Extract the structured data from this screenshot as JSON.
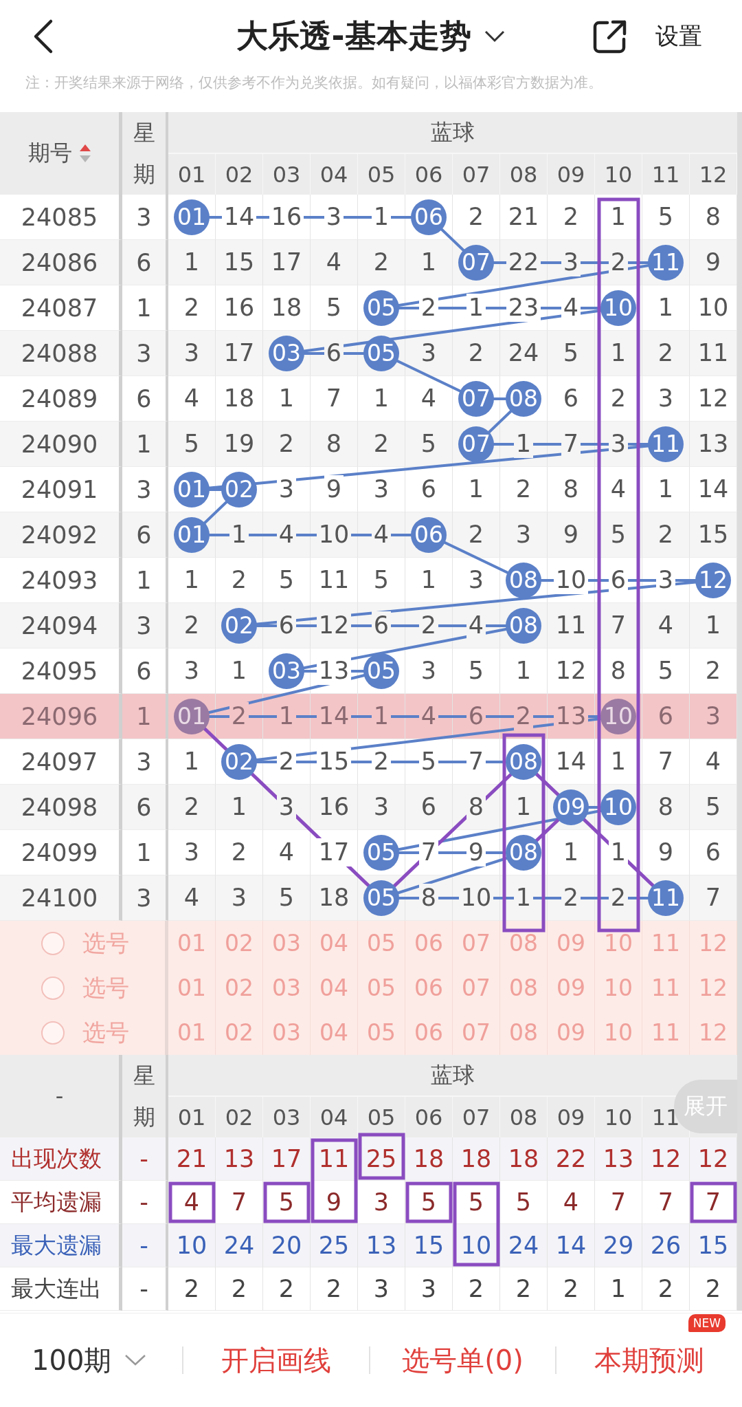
{
  "header": {
    "title": "大乐透-基本走势",
    "action": "设置"
  },
  "notice": "注：开奖结果来源于网络，仅供参考不作为兑奖依据。如有疑问，以福体彩官方数据为准。",
  "table": {
    "period_label": "期号",
    "sort_ascending": true,
    "weekday_top": "星",
    "weekday_bottom": "期",
    "group": "蓝球",
    "numbers": [
      "01",
      "02",
      "03",
      "04",
      "05",
      "06",
      "07",
      "08",
      "09",
      "10",
      "11",
      "12"
    ],
    "rows": [
      {
        "period": "24085",
        "weekday": "3",
        "selected": false,
        "cells": [
          {
            "text": "01",
            "hit": true
          },
          {
            "text": "14",
            "hit": false
          },
          {
            "text": "16",
            "hit": false
          },
          {
            "text": "3",
            "hit": false
          },
          {
            "text": "1",
            "hit": false
          },
          {
            "text": "06",
            "hit": true
          },
          {
            "text": "2",
            "hit": false
          },
          {
            "text": "21",
            "hit": false
          },
          {
            "text": "2",
            "hit": false
          },
          {
            "text": "1",
            "hit": false
          },
          {
            "text": "5",
            "hit": false
          },
          {
            "text": "8",
            "hit": false
          }
        ]
      },
      {
        "period": "24086",
        "weekday": "6",
        "selected": false,
        "cells": [
          {
            "text": "1",
            "hit": false
          },
          {
            "text": "15",
            "hit": false
          },
          {
            "text": "17",
            "hit": false
          },
          {
            "text": "4",
            "hit": false
          },
          {
            "text": "2",
            "hit": false
          },
          {
            "text": "1",
            "hit": false
          },
          {
            "text": "07",
            "hit": true
          },
          {
            "text": "22",
            "hit": false
          },
          {
            "text": "3",
            "hit": false
          },
          {
            "text": "2",
            "hit": false
          },
          {
            "text": "11",
            "hit": true
          },
          {
            "text": "9",
            "hit": false
          }
        ]
      },
      {
        "period": "24087",
        "weekday": "1",
        "selected": false,
        "cells": [
          {
            "text": "2",
            "hit": false
          },
          {
            "text": "16",
            "hit": false
          },
          {
            "text": "18",
            "hit": false
          },
          {
            "text": "5",
            "hit": false
          },
          {
            "text": "05",
            "hit": true
          },
          {
            "text": "2",
            "hit": false
          },
          {
            "text": "1",
            "hit": false
          },
          {
            "text": "23",
            "hit": false
          },
          {
            "text": "4",
            "hit": false
          },
          {
            "text": "10",
            "hit": true
          },
          {
            "text": "1",
            "hit": false
          },
          {
            "text": "10",
            "hit": false
          }
        ]
      },
      {
        "period": "24088",
        "weekday": "3",
        "selected": false,
        "cells": [
          {
            "text": "3",
            "hit": false
          },
          {
            "text": "17",
            "hit": false
          },
          {
            "text": "03",
            "hit": true
          },
          {
            "text": "6",
            "hit": false
          },
          {
            "text": "05",
            "hit": true
          },
          {
            "text": "3",
            "hit": false
          },
          {
            "text": "2",
            "hit": false
          },
          {
            "text": "24",
            "hit": false
          },
          {
            "text": "5",
            "hit": false
          },
          {
            "text": "1",
            "hit": false
          },
          {
            "text": "2",
            "hit": false
          },
          {
            "text": "11",
            "hit": false
          }
        ]
      },
      {
        "period": "24089",
        "weekday": "6",
        "selected": false,
        "cells": [
          {
            "text": "4",
            "hit": false
          },
          {
            "text": "18",
            "hit": false
          },
          {
            "text": "1",
            "hit": false
          },
          {
            "text": "7",
            "hit": false
          },
          {
            "text": "1",
            "hit": false
          },
          {
            "text": "4",
            "hit": false
          },
          {
            "text": "07",
            "hit": true
          },
          {
            "text": "08",
            "hit": true
          },
          {
            "text": "6",
            "hit": false
          },
          {
            "text": "2",
            "hit": false
          },
          {
            "text": "3",
            "hit": false
          },
          {
            "text": "12",
            "hit": false
          }
        ]
      },
      {
        "period": "24090",
        "weekday": "1",
        "selected": false,
        "cells": [
          {
            "text": "5",
            "hit": false
          },
          {
            "text": "19",
            "hit": false
          },
          {
            "text": "2",
            "hit": false
          },
          {
            "text": "8",
            "hit": false
          },
          {
            "text": "2",
            "hit": false
          },
          {
            "text": "5",
            "hit": false
          },
          {
            "text": "07",
            "hit": true
          },
          {
            "text": "1",
            "hit": false
          },
          {
            "text": "7",
            "hit": false
          },
          {
            "text": "3",
            "hit": false
          },
          {
            "text": "11",
            "hit": true
          },
          {
            "text": "13",
            "hit": false
          }
        ]
      },
      {
        "period": "24091",
        "weekday": "3",
        "selected": false,
        "cells": [
          {
            "text": "01",
            "hit": true
          },
          {
            "text": "02",
            "hit": true
          },
          {
            "text": "3",
            "hit": false
          },
          {
            "text": "9",
            "hit": false
          },
          {
            "text": "3",
            "hit": false
          },
          {
            "text": "6",
            "hit": false
          },
          {
            "text": "1",
            "hit": false
          },
          {
            "text": "2",
            "hit": false
          },
          {
            "text": "8",
            "hit": false
          },
          {
            "text": "4",
            "hit": false
          },
          {
            "text": "1",
            "hit": false
          },
          {
            "text": "14",
            "hit": false
          }
        ]
      },
      {
        "period": "24092",
        "weekday": "6",
        "selected": false,
        "cells": [
          {
            "text": "01",
            "hit": true
          },
          {
            "text": "1",
            "hit": false
          },
          {
            "text": "4",
            "hit": false
          },
          {
            "text": "10",
            "hit": false
          },
          {
            "text": "4",
            "hit": false
          },
          {
            "text": "06",
            "hit": true
          },
          {
            "text": "2",
            "hit": false
          },
          {
            "text": "3",
            "hit": false
          },
          {
            "text": "9",
            "hit": false
          },
          {
            "text": "5",
            "hit": false
          },
          {
            "text": "2",
            "hit": false
          },
          {
            "text": "15",
            "hit": false
          }
        ]
      },
      {
        "period": "24093",
        "weekday": "1",
        "selected": false,
        "cells": [
          {
            "text": "1",
            "hit": false
          },
          {
            "text": "2",
            "hit": false
          },
          {
            "text": "5",
            "hit": false
          },
          {
            "text": "11",
            "hit": false
          },
          {
            "text": "5",
            "hit": false
          },
          {
            "text": "1",
            "hit": false
          },
          {
            "text": "3",
            "hit": false
          },
          {
            "text": "08",
            "hit": true
          },
          {
            "text": "10",
            "hit": false
          },
          {
            "text": "6",
            "hit": false
          },
          {
            "text": "3",
            "hit": false
          },
          {
            "text": "12",
            "hit": true
          }
        ]
      },
      {
        "period": "24094",
        "weekday": "3",
        "selected": false,
        "cells": [
          {
            "text": "2",
            "hit": false
          },
          {
            "text": "02",
            "hit": true
          },
          {
            "text": "6",
            "hit": false
          },
          {
            "text": "12",
            "hit": false
          },
          {
            "text": "6",
            "hit": false
          },
          {
            "text": "2",
            "hit": false
          },
          {
            "text": "4",
            "hit": false
          },
          {
            "text": "08",
            "hit": true
          },
          {
            "text": "11",
            "hit": false
          },
          {
            "text": "7",
            "hit": false
          },
          {
            "text": "4",
            "hit": false
          },
          {
            "text": "1",
            "hit": false
          }
        ]
      },
      {
        "period": "24095",
        "weekday": "6",
        "selected": false,
        "cells": [
          {
            "text": "3",
            "hit": false
          },
          {
            "text": "1",
            "hit": false
          },
          {
            "text": "03",
            "hit": true
          },
          {
            "text": "13",
            "hit": false
          },
          {
            "text": "05",
            "hit": true
          },
          {
            "text": "3",
            "hit": false
          },
          {
            "text": "5",
            "hit": false
          },
          {
            "text": "1",
            "hit": false
          },
          {
            "text": "12",
            "hit": false
          },
          {
            "text": "8",
            "hit": false
          },
          {
            "text": "5",
            "hit": false
          },
          {
            "text": "2",
            "hit": false
          }
        ]
      },
      {
        "period": "24096",
        "weekday": "1",
        "selected": true,
        "cells": [
          {
            "text": "01",
            "hit": true
          },
          {
            "text": "2",
            "hit": false
          },
          {
            "text": "1",
            "hit": false
          },
          {
            "text": "14",
            "hit": false
          },
          {
            "text": "1",
            "hit": false
          },
          {
            "text": "4",
            "hit": false
          },
          {
            "text": "6",
            "hit": false
          },
          {
            "text": "2",
            "hit": false
          },
          {
            "text": "13",
            "hit": false
          },
          {
            "text": "10",
            "hit": true
          },
          {
            "text": "6",
            "hit": false
          },
          {
            "text": "3",
            "hit": false
          }
        ]
      },
      {
        "period": "24097",
        "weekday": "3",
        "selected": false,
        "cells": [
          {
            "text": "1",
            "hit": false
          },
          {
            "text": "02",
            "hit": true
          },
          {
            "text": "2",
            "hit": false
          },
          {
            "text": "15",
            "hit": false
          },
          {
            "text": "2",
            "hit": false
          },
          {
            "text": "5",
            "hit": false
          },
          {
            "text": "7",
            "hit": false
          },
          {
            "text": "08",
            "hit": true
          },
          {
            "text": "14",
            "hit": false
          },
          {
            "text": "1",
            "hit": false
          },
          {
            "text": "7",
            "hit": false
          },
          {
            "text": "4",
            "hit": false
          }
        ]
      },
      {
        "period": "24098",
        "weekday": "6",
        "selected": false,
        "cells": [
          {
            "text": "2",
            "hit": false
          },
          {
            "text": "1",
            "hit": false
          },
          {
            "text": "3",
            "hit": false
          },
          {
            "text": "16",
            "hit": false
          },
          {
            "text": "3",
            "hit": false
          },
          {
            "text": "6",
            "hit": false
          },
          {
            "text": "8",
            "hit": false
          },
          {
            "text": "1",
            "hit": false
          },
          {
            "text": "09",
            "hit": true
          },
          {
            "text": "10",
            "hit": true
          },
          {
            "text": "8",
            "hit": false
          },
          {
            "text": "5",
            "hit": false
          }
        ]
      },
      {
        "period": "24099",
        "weekday": "1",
        "selected": false,
        "cells": [
          {
            "text": "3",
            "hit": false
          },
          {
            "text": "2",
            "hit": false
          },
          {
            "text": "4",
            "hit": false
          },
          {
            "text": "17",
            "hit": false
          },
          {
            "text": "05",
            "hit": true
          },
          {
            "text": "7",
            "hit": false
          },
          {
            "text": "9",
            "hit": false
          },
          {
            "text": "08",
            "hit": true
          },
          {
            "text": "1",
            "hit": false
          },
          {
            "text": "1",
            "hit": false
          },
          {
            "text": "9",
            "hit": false
          },
          {
            "text": "6",
            "hit": false
          }
        ]
      },
      {
        "period": "24100",
        "weekday": "3",
        "selected": false,
        "cells": [
          {
            "text": "4",
            "hit": false
          },
          {
            "text": "3",
            "hit": false
          },
          {
            "text": "5",
            "hit": false
          },
          {
            "text": "18",
            "hit": false
          },
          {
            "text": "05",
            "hit": true
          },
          {
            "text": "8",
            "hit": false
          },
          {
            "text": "10",
            "hit": false
          },
          {
            "text": "1",
            "hit": false
          },
          {
            "text": "2",
            "hit": false
          },
          {
            "text": "2",
            "hit": false
          },
          {
            "text": "11",
            "hit": true
          },
          {
            "text": "7",
            "hit": false
          }
        ]
      }
    ]
  },
  "pick_rows": [
    {
      "label": "选号",
      "checked": false,
      "numbers": [
        "01",
        "02",
        "03",
        "04",
        "05",
        "06",
        "07",
        "08",
        "09",
        "10",
        "11",
        "12"
      ]
    },
    {
      "label": "选号",
      "checked": false,
      "numbers": [
        "01",
        "02",
        "03",
        "04",
        "05",
        "06",
        "07",
        "08",
        "09",
        "10",
        "11",
        "12"
      ]
    },
    {
      "label": "选号",
      "checked": false,
      "numbers": [
        "01",
        "02",
        "03",
        "04",
        "05",
        "06",
        "07",
        "08",
        "09",
        "10",
        "11",
        "12"
      ]
    }
  ],
  "stats": {
    "corner": "-",
    "weekday_top": "星",
    "weekday_bottom": "期",
    "group": "蓝球",
    "expand": "展开",
    "numbers": [
      "01",
      "02",
      "03",
      "04",
      "05",
      "06",
      "07",
      "08",
      "09",
      "10",
      "11"
    ],
    "rows": [
      {
        "label": "出现次数",
        "weekday": "-",
        "color": "#b0302e",
        "values": [
          "21",
          "13",
          "17",
          "11",
          "25",
          "18",
          "18",
          "18",
          "22",
          "13",
          "12",
          "12"
        ]
      },
      {
        "label": "平均遗漏",
        "weekday": "-",
        "color": "#8c2a2a",
        "values": [
          "4",
          "7",
          "5",
          "9",
          "3",
          "5",
          "5",
          "5",
          "4",
          "7",
          "7",
          "7"
        ]
      },
      {
        "label": "最大遗漏",
        "weekday": "-",
        "color": "#3b62b8",
        "values": [
          "10",
          "24",
          "20",
          "25",
          "13",
          "15",
          "10",
          "24",
          "14",
          "29",
          "26",
          "15"
        ]
      },
      {
        "label": "最大连出",
        "weekday": "-",
        "color": "#444444",
        "values": [
          "2",
          "2",
          "2",
          "2",
          "3",
          "3",
          "2",
          "2",
          "2",
          "1",
          "2",
          "2"
        ]
      }
    ]
  },
  "bottom_bar": {
    "period_select": "100期",
    "actions": [
      {
        "label": "开启画线"
      },
      {
        "label": "选号单(0)"
      },
      {
        "label": "本期预测",
        "badge": "NEW"
      }
    ]
  }
}
